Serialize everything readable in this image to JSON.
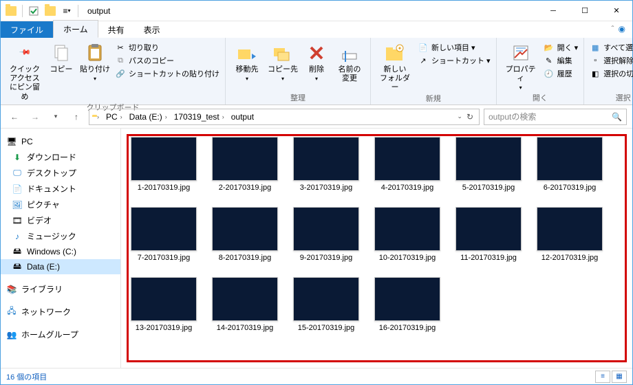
{
  "window": {
    "title": "output"
  },
  "qat": {
    "dropdown": "▾"
  },
  "tabs": {
    "file": "ファイル",
    "home": "ホーム",
    "share": "共有",
    "view": "表示"
  },
  "ribbon": {
    "clipboard": {
      "label": "クリップボード",
      "quickaccess": "クイック アクセス\nにピン留め",
      "copy": "コピー",
      "paste": "貼り付け",
      "cut": "切り取り",
      "copypath": "パスのコピー",
      "pasteshort": "ショートカットの貼り付け"
    },
    "organize": {
      "label": "整理",
      "moveto": "移動先",
      "copyto": "コピー先",
      "delete": "削除",
      "rename": "名前の\n変更"
    },
    "new": {
      "label": "新規",
      "newfolder": "新しい\nフォルダー",
      "newitem": "新しい項目 ▾",
      "shortcut": "ショートカット ▾"
    },
    "open": {
      "label": "開く",
      "properties": "プロパティ",
      "open": "開く ▾",
      "edit": "編集",
      "history": "履歴"
    },
    "select": {
      "label": "選択",
      "all": "すべて選択",
      "none": "選択解除",
      "invert": "選択の切り替え"
    }
  },
  "breadcrumb": {
    "pc": "PC",
    "drive": "Data (E:)",
    "folder1": "170319_test",
    "folder2": "output"
  },
  "search": {
    "placeholder": "outputの検索"
  },
  "tree": {
    "pc": "PC",
    "downloads": "ダウンロード",
    "desktop": "デスクトップ",
    "documents": "ドキュメント",
    "pictures": "ピクチャ",
    "videos": "ビデオ",
    "music": "ミュージック",
    "cdrive": "Windows (C:)",
    "edrive": "Data (E:)",
    "library": "ライブラリ",
    "network": "ネットワーク",
    "homegroup": "ホームグループ"
  },
  "files": [
    {
      "name": "1-20170319.jpg",
      "cls": "p1"
    },
    {
      "name": "2-20170319.jpg",
      "cls": "p2"
    },
    {
      "name": "3-20170319.jpg",
      "cls": "p3"
    },
    {
      "name": "4-20170319.jpg",
      "cls": "p4"
    },
    {
      "name": "5-20170319.jpg",
      "cls": "p5"
    },
    {
      "name": "6-20170319.jpg",
      "cls": "p6"
    },
    {
      "name": "7-20170319.jpg",
      "cls": "p7"
    },
    {
      "name": "8-20170319.jpg",
      "cls": "p8"
    },
    {
      "name": "9-20170319.jpg",
      "cls": "p9"
    },
    {
      "name": "10-20170319.jpg",
      "cls": "p10"
    },
    {
      "name": "11-20170319.jpg",
      "cls": "p11"
    },
    {
      "name": "12-20170319.jpg",
      "cls": "p12"
    },
    {
      "name": "13-20170319.jpg",
      "cls": "p13"
    },
    {
      "name": "14-20170319.jpg",
      "cls": "p14"
    },
    {
      "name": "15-20170319.jpg",
      "cls": "p15"
    },
    {
      "name": "16-20170319.jpg",
      "cls": "p16"
    }
  ],
  "status": {
    "count": "16 個の項目"
  }
}
